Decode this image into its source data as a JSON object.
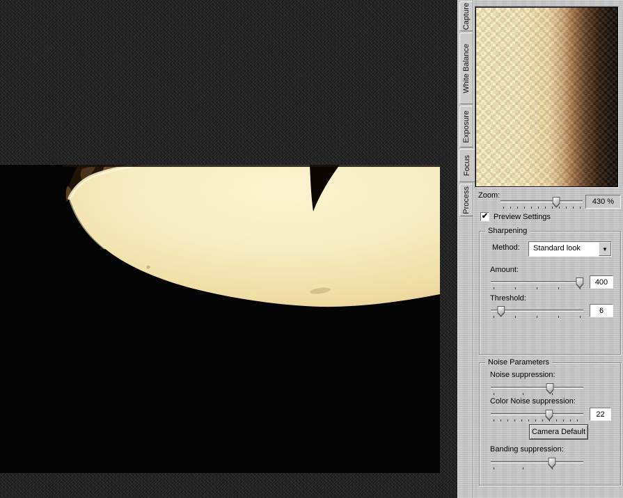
{
  "colors": {
    "panel_bg": "#c7c7c7",
    "canvas_bg": "#272727",
    "lamp_cream": "#f5eabc",
    "photo_black": "#050505"
  },
  "icons": {
    "checkmark": "✔",
    "dropdown_arrow": "▼"
  },
  "tabs": {
    "active": "Focus",
    "items": [
      "Capture",
      "White Balance",
      "Exposure",
      "Focus",
      "Process"
    ]
  },
  "zoom_control": {
    "label": "Zoom:",
    "value": "430 %",
    "percent": 68
  },
  "preview_settings": {
    "label": "Preview Settings",
    "checked": true
  },
  "sharpening": {
    "title": "Sharpening",
    "method": {
      "label": "Method:",
      "value": "Standard look"
    },
    "amount": {
      "label": "Amount:",
      "value": "400",
      "percent": 96
    },
    "threshold": {
      "label": "Threshold:",
      "value": "6",
      "percent": 11
    }
  },
  "noise_parameters": {
    "title": "Noise Parameters",
    "noise_suppression": {
      "label": "Noise suppression:",
      "percent": 64
    },
    "color_noise_suppression": {
      "label": "Color Noise suppression:",
      "value": "22",
      "percent": 63
    },
    "camera_default_button": "Camera Default",
    "banding_suppression": {
      "label": "Banding suppression:",
      "percent": 66
    }
  }
}
